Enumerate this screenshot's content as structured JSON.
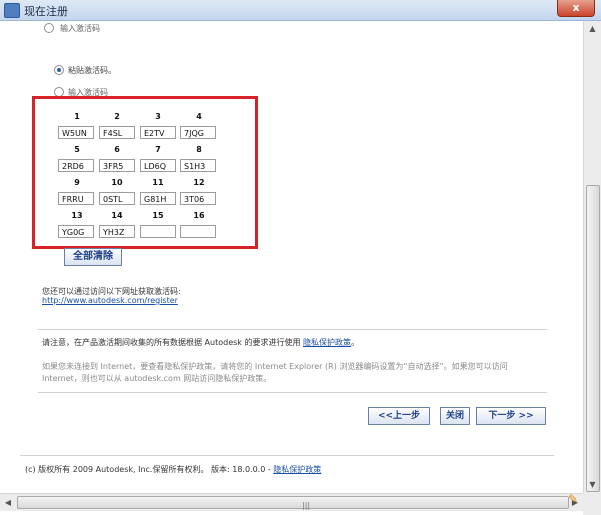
{
  "window": {
    "title": "现在注册",
    "close_label": "x"
  },
  "radio_options": [
    {
      "label": "输入激活码",
      "checked": false
    },
    {
      "label": "粘贴激活码。",
      "checked": true
    },
    {
      "label": "输入激活码",
      "checked": false
    }
  ],
  "activation_code": {
    "segments": [
      {
        "n": "1",
        "value": "W5UN"
      },
      {
        "n": "2",
        "value": "F4SL"
      },
      {
        "n": "3",
        "value": "E2TV"
      },
      {
        "n": "4",
        "value": "7JQG"
      },
      {
        "n": "5",
        "value": "2RD6"
      },
      {
        "n": "6",
        "value": "3FR5"
      },
      {
        "n": "7",
        "value": "LD6Q"
      },
      {
        "n": "8",
        "value": "S1H3"
      },
      {
        "n": "9",
        "value": "FRRU"
      },
      {
        "n": "10",
        "value": "0STL"
      },
      {
        "n": "11",
        "value": "G81H"
      },
      {
        "n": "12",
        "value": "3T06"
      },
      {
        "n": "13",
        "value": "YG0G"
      },
      {
        "n": "14",
        "value": "YH3Z"
      },
      {
        "n": "15",
        "value": ""
      },
      {
        "n": "16",
        "value": ""
      }
    ],
    "clear_all_label": "全部清除"
  },
  "info": {
    "text": "您还可以通过访问以下网址获取激活码:",
    "url": "http://www.autodesk.com/register"
  },
  "notice": {
    "prefix": "请注意，在产品激活期间收集的所有数据根据 Autodesk 的要求进行使用",
    "privacy_link": "隐私保护政策",
    "suffix": "。",
    "gray_line1": "如果您未连接到 Internet，要查看隐私保护政策，请将您的 Internet Explorer (R) 浏览器编码设置为“自动选择”。如果您可以访问",
    "gray_line2": "Internet，则也可以从 autodesk.com 网站访问隐私保护政策。"
  },
  "nav": {
    "back": "<<上一步",
    "close": "关闭",
    "next": "下一步 >>"
  },
  "footer": {
    "text": "(c) 版权所有 2009 Autodesk, Inc.保留所有权利。 版本: 18.0.0.0 -",
    "privacy_link": "隐私保护政策"
  },
  "scroll": {
    "grip": "|||"
  }
}
